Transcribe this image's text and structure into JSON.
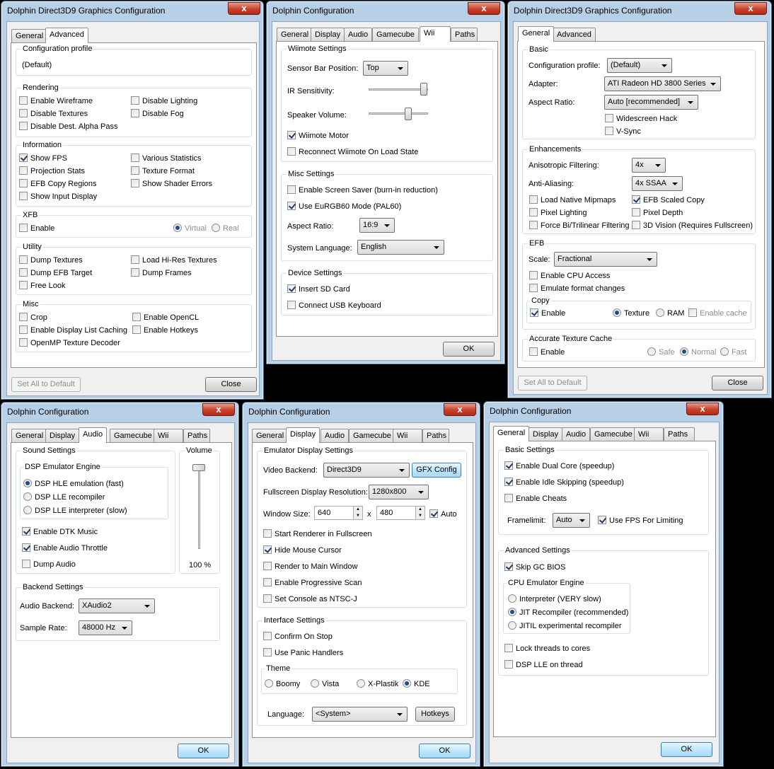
{
  "w1": {
    "title": "Dolphin Direct3D9 Graphics Configuration",
    "close": "x",
    "tabs": [
      "General",
      "Advanced"
    ],
    "profile": {
      "label": "Configuration profile",
      "value": "(Default)"
    },
    "rendering": {
      "label": "Rendering",
      "items": [
        "Enable Wireframe",
        "Disable Lighting",
        "Disable Textures",
        "Disable Fog",
        "Disable Dest. Alpha Pass"
      ]
    },
    "information": {
      "label": "Information",
      "items": [
        "Show FPS",
        "Various Statistics",
        "Projection Stats",
        "Texture Format",
        "EFB Copy Regions",
        "Show Shader Errors",
        "Show Input Display"
      ]
    },
    "xfb": {
      "label": "XFB",
      "enable": "Enable",
      "virtual": "Virtual",
      "real": "Real"
    },
    "utility": {
      "label": "Utility",
      "items": [
        "Dump Textures",
        "Load Hi-Res Textures",
        "Dump EFB Target",
        "Dump Frames",
        "Free Look"
      ]
    },
    "misc": {
      "label": "Misc",
      "items": [
        "Crop",
        "Enable OpenCL",
        "Enable Display List Caching",
        "Enable Hotkeys",
        "OpenMP Texture Decoder"
      ]
    },
    "set_default": "Set All to Default",
    "close_btn": "Close"
  },
  "w2": {
    "title": "Dolphin Configuration",
    "close": "x",
    "tabs": [
      "General",
      "Display",
      "Audio",
      "Gamecube",
      "Wii",
      "Paths"
    ],
    "wiimote": {
      "label": "Wiimote Settings",
      "sensor_label": "Sensor Bar Position:",
      "sensor_value": "Top",
      "ir": "IR Sensitivity:",
      "speaker": "Speaker Volume:",
      "motor": "Wiimote Motor",
      "reconnect": "Reconnect Wiimote On Load State"
    },
    "misc": {
      "label": "Misc Settings",
      "screensaver": "Enable Screen Saver (burn-in reduction)",
      "eurgb": "Use EuRGB60 Mode (PAL60)",
      "aspect_label": "Aspect Ratio:",
      "aspect_value": "16:9",
      "lang_label": "System Language:",
      "lang_value": "English"
    },
    "device": {
      "label": "Device Settings",
      "sd": "Insert SD Card",
      "usb": "Connect USB Keyboard"
    },
    "ok": "OK"
  },
  "w3": {
    "title": "Dolphin Direct3D9 Graphics Configuration",
    "close": "x",
    "tabs": [
      "General",
      "Advanced"
    ],
    "basic": {
      "label": "Basic",
      "profile_label": "Configuration profile:",
      "profile_value": "(Default)",
      "adapter_label": "Adapter:",
      "adapter_value": "ATI Radeon HD 3800 Series",
      "aspect_label": "Aspect Ratio:",
      "aspect_value": "Auto [recommended]",
      "widescreen": "Widescreen Hack",
      "vsync": "V-Sync"
    },
    "enh": {
      "label": "Enhancements",
      "aniso_label": "Anisotropic Filtering:",
      "aniso_value": "4x",
      "aa_label": "Anti-Aliasing:",
      "aa_value": "4x SSAA",
      "items": [
        "Load Native Mipmaps",
        "EFB Scaled Copy",
        "Pixel Lighting",
        "Pixel Depth",
        "Force Bi/Trilinear Filtering",
        "3D Vision (Requires Fullscreen)"
      ]
    },
    "efb": {
      "label": "EFB",
      "scale_label": "Scale:",
      "scale_value": "Fractional",
      "cpu": "Enable CPU Access",
      "emulate": "Emulate format changes",
      "copy_label": "Copy",
      "copy_enable": "Enable",
      "texture": "Texture",
      "ram": "RAM",
      "cache": "Enable cache"
    },
    "atc": {
      "label": "Accurate Texture Cache",
      "enable": "Enable",
      "safe": "Safe",
      "normal": "Normal",
      "fast": "Fast"
    },
    "set_default": "Set All to Default",
    "close_btn": "Close"
  },
  "w4": {
    "title": "Dolphin Configuration",
    "close": "x",
    "tabs": [
      "General",
      "Display",
      "Audio",
      "Gamecube",
      "Wii",
      "Paths"
    ],
    "sound": {
      "label": "Sound Settings",
      "dsp_label": "DSP Emulator Engine",
      "hle": "DSP HLE emulation (fast)",
      "lle_rec": "DSP LLE recompiler",
      "lle_int": "DSP LLE interpreter (slow)",
      "dtk": "Enable DTK Music",
      "throttle": "Enable Audio Throttle",
      "dump": "Dump Audio"
    },
    "volume": {
      "label": "Volume",
      "value": "100 %"
    },
    "backend": {
      "label": "Backend Settings",
      "audio_label": "Audio Backend:",
      "audio_value": "XAudio2",
      "rate_label": "Sample Rate:",
      "rate_value": "48000 Hz"
    },
    "ok": "OK"
  },
  "w5": {
    "title": "Dolphin Configuration",
    "close": "x",
    "tabs": [
      "General",
      "Display",
      "Audio",
      "Gamecube",
      "Wii",
      "Paths"
    ],
    "emu": {
      "label": "Emulator Display Settings",
      "backend_label": "Video Backend:",
      "backend_value": "Direct3D9",
      "gfx": "GFX Config",
      "fs_label": "Fullscreen Display Resolution:",
      "fs_value": "1280x800",
      "ws_label": "Window Size:",
      "w": "640",
      "x": "x",
      "h": "480",
      "auto": "Auto",
      "start_fs": "Start Renderer in Fullscreen",
      "hide_cursor": "Hide Mouse Cursor",
      "render_main": "Render to Main Window",
      "prog": "Enable Progressive Scan",
      "ntsc": "Set Console as NTSC-J"
    },
    "iface": {
      "label": "Interface Settings",
      "confirm": "Confirm On Stop",
      "panic": "Use Panic Handlers",
      "theme_label": "Theme",
      "boomy": "Boomy",
      "vista": "Vista",
      "xplastik": "X-Plastik",
      "kde": "KDE",
      "lang_label": "Language:",
      "lang_value": "<System>",
      "hotkeys": "Hotkeys"
    },
    "ok": "OK"
  },
  "w6": {
    "title": "Dolphin Configuration",
    "close": "x",
    "tabs": [
      "General",
      "Display",
      "Audio",
      "Gamecube",
      "Wii",
      "Paths"
    ],
    "basic": {
      "label": "Basic Settings",
      "dual": "Enable Dual Core (speedup)",
      "idle": "Enable Idle Skipping (speedup)",
      "cheats": "Enable Cheats",
      "frame_label": "Framelimit:",
      "frame_value": "Auto",
      "fps": "Use FPS For Limiting"
    },
    "adv": {
      "label": "Advanced Settings",
      "skip": "Skip GC BIOS",
      "cpu_label": "CPU Emulator Engine",
      "interp": "Interpreter (VERY slow)",
      "jit": "JIT Recompiler (recommended)",
      "jitil": "JITIL experimental recompiler",
      "lock": "Lock threads to cores",
      "dsplle": "DSP LLE on thread"
    },
    "ok": "OK"
  }
}
